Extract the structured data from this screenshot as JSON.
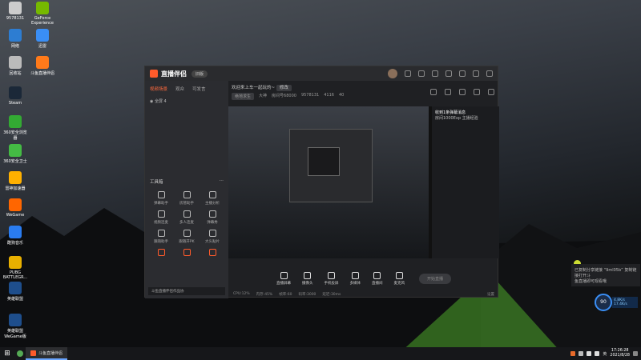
{
  "desktop_icons": [
    {
      "label": "9578131",
      "top_label": "",
      "color": "#cccccc"
    },
    {
      "label": "GeForce Experience",
      "color": "#76b900"
    },
    {
      "label": "网络",
      "color": "#2d7dd2"
    },
    {
      "label": "迅雷",
      "color": "#3a8ef5"
    },
    {
      "label": "回收站",
      "color": "#bbbbbb"
    },
    {
      "label": "斗鱼直播伴侣",
      "color": "#ff7a1a"
    },
    {
      "label": "Steam",
      "color": "#1b2838"
    },
    {
      "label": "360安全浏览器",
      "color": "#33aa33"
    },
    {
      "label": "360安全卫士",
      "color": "#44bb44"
    },
    {
      "label": "雷神加速器",
      "color": "#ffb000"
    },
    {
      "label": "WeGame",
      "color": "#ff6600"
    },
    {
      "label": "酷狗音乐",
      "color": "#2a7cf0"
    },
    {
      "label": "PUBG BATTLEGR...",
      "color": "#e8b000"
    },
    {
      "label": "英雄联盟",
      "color": "#1e4e8c"
    },
    {
      "label": "英雄联盟WeGame版",
      "color": "#1e4e8c"
    }
  ],
  "app": {
    "name": "直播伴侣",
    "version_badge": "旧版",
    "left_tabs": [
      "视频场景",
      "观众",
      "可发言"
    ],
    "scene_label": "全屏 4",
    "tools_header": "工具箱",
    "tools": [
      "弹幕助手",
      "房管助手",
      "主播分析",
      "视频连麦",
      "多人连麦",
      "弹幕秀",
      "跟随助手",
      "跟随开PK",
      "大头贴片",
      "",
      "",
      ""
    ],
    "status_text": "斗鱼直播伴侣作品协",
    "stream_title": "欢迎来上车一起玩的~",
    "edit_label": "修改",
    "game_pill": "绝地求生",
    "category_pill": "大神",
    "room_id": "房间号68000",
    "room_num": "9578131",
    "stat1": "4116",
    "stat2": "40",
    "chat_title": "收到1条弹幕消息",
    "chat_sub": "房间1000Exp 主播经验",
    "bottom_tools": [
      "直播屏幕",
      "摄像头",
      "手机投屏",
      "多媒体",
      "直播间",
      "麦克风"
    ],
    "golive": "开始直播",
    "bottom_links": [
      "CPU:12%",
      "内存:45%",
      "帧率:60",
      "码率:3000",
      "延迟:30ms"
    ],
    "footer_btn": "设置"
  },
  "notification": {
    "line1": "已复制分享链接 “9ml05b” 复制链接打开斗",
    "line2": "鱼直播即可观看哦"
  },
  "widget": {
    "value": "90",
    "unit": "%",
    "up": "4.8K/s",
    "down": "17.4K/s"
  },
  "taskbar": {
    "task_label": "斗鱼直播伴侣",
    "time": "17:26:28",
    "date": "2021/8/28",
    "lang": "英"
  }
}
